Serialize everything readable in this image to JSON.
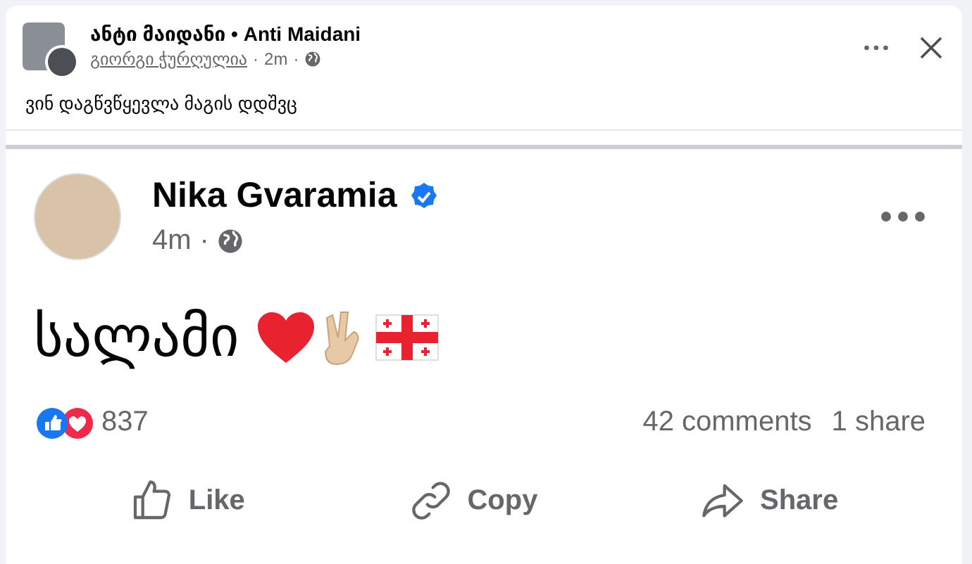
{
  "separator": "·",
  "share_header": {
    "page_name": "ანტი მაიდანი • Anti Maidani",
    "author": "გიორგი ჭურღულია",
    "time": "2m",
    "caption": "ვინ დაგწვწყევლა მაგის დდშვც"
  },
  "post": {
    "author": "Nika Gvaramia",
    "verified": true,
    "time": "4m",
    "text": "სალამი",
    "emojis": [
      {
        "kind": "heart"
      },
      {
        "kind": "victory-hand"
      },
      {
        "kind": "flag"
      }
    ]
  },
  "reactions": {
    "kinds": [
      {
        "kind": "like"
      },
      {
        "kind": "love"
      }
    ],
    "count": "837"
  },
  "comments": "42 comments",
  "shares": "1 share",
  "actions": [
    {
      "kind": "like",
      "label": "Like"
    },
    {
      "kind": "copy",
      "label": "Copy"
    },
    {
      "kind": "share",
      "label": "Share"
    }
  ]
}
